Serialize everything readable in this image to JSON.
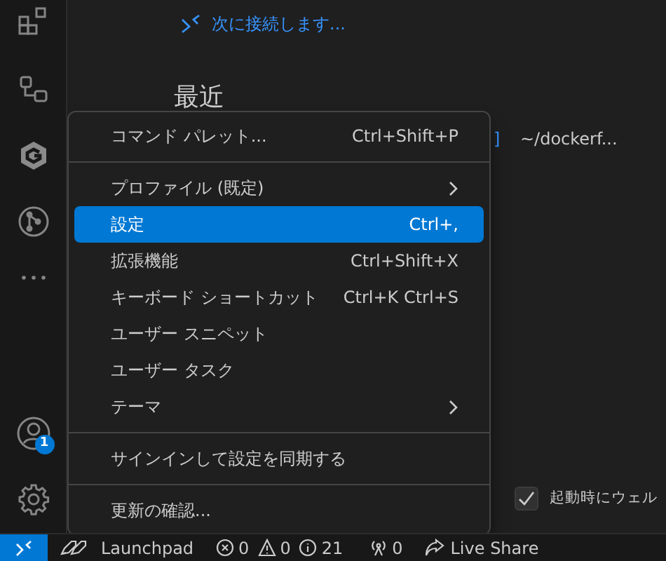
{
  "welcome": {
    "connect_link": "次に接続します...",
    "recent_heading": "最近",
    "recent_row": {
      "bracket": "]",
      "path": "~/dockerf..."
    },
    "startup_checkbox": {
      "label": "起動時にウェル",
      "checked": true
    }
  },
  "activity_bar": {
    "account_badge": "1"
  },
  "menu": [
    {
      "kind": "item",
      "label": "コマンド パレット...",
      "shortcut": "Ctrl+Shift+P",
      "submenu": false,
      "selected": false
    },
    {
      "kind": "separator"
    },
    {
      "kind": "item",
      "label": "プロファイル (既定)",
      "submenu": true,
      "selected": false
    },
    {
      "kind": "item",
      "label": "設定",
      "shortcut": "Ctrl+,",
      "submenu": false,
      "selected": true
    },
    {
      "kind": "item",
      "label": "拡張機能",
      "shortcut": "Ctrl+Shift+X",
      "submenu": false,
      "selected": false
    },
    {
      "kind": "item",
      "label": "キーボード ショートカット",
      "shortcut": "Ctrl+K Ctrl+S",
      "submenu": false,
      "selected": false
    },
    {
      "kind": "item",
      "label": "ユーザー スニペット",
      "submenu": false,
      "selected": false
    },
    {
      "kind": "item",
      "label": "ユーザー タスク",
      "submenu": false,
      "selected": false
    },
    {
      "kind": "item",
      "label": "テーマ",
      "submenu": true,
      "selected": false
    },
    {
      "kind": "separator"
    },
    {
      "kind": "item",
      "label": "サインインして設定を同期する",
      "submenu": false,
      "selected": false
    },
    {
      "kind": "separator"
    },
    {
      "kind": "item",
      "label": "更新の確認...",
      "submenu": false,
      "selected": false
    }
  ],
  "status_bar": {
    "launchpad": "Launchpad",
    "errors": "0",
    "warnings": "0",
    "infos": "21",
    "ports": "0",
    "live_share": "Live Share"
  }
}
